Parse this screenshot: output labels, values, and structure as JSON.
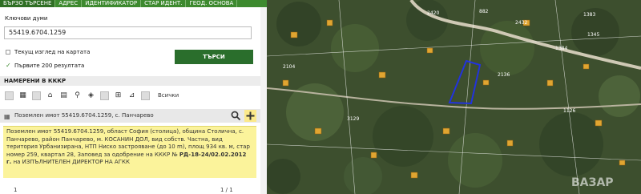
{
  "tabs": [
    {
      "label": "БЪРЗО ТЪРСЕНЕ",
      "active": true
    },
    {
      "label": "АДРЕС",
      "active": false
    },
    {
      "label": "ИДЕНТИФИКАТОР",
      "active": false
    },
    {
      "label": "СТАР ИДЕНТ.",
      "active": false
    },
    {
      "label": "ГЕОД. ОСНОВА",
      "active": false
    }
  ],
  "search": {
    "keywords_label": "Ключови думи",
    "value": "55419.6704.1259",
    "current_view_label": "Текущ изглед на картата",
    "first200_label": "Първите 200 резултата",
    "search_button": "ТЪРСИ"
  },
  "found": {
    "header": "НАМЕРЕНИ В КККР",
    "all_label": "Всички",
    "icons": [
      "grid-icon",
      "building-icon",
      "home-icon",
      "document-icon",
      "pin-icon",
      "layers-icon",
      "line-icon",
      "boundary-icon",
      "polygon-icon"
    ]
  },
  "results": {
    "title": "Поземлен имот 55419.6704.1259, с. Панчарево",
    "description": "Поземлен имот 55419.6704.1259, област София (столица), община Столична, с. Панчарево, район Панчарево, м. КОСАНИН ДОЛ, вид собств. Частна, вид територия Урбанизирана, НТП Ниско застрояване (до 10 m), площ 934 кв. м, стар номер 259, квартал 28,",
    "order_prefix": "Заповед за одобрение на КККР №",
    "order_number": "РД-18-24/02.02.2012 г.",
    "order_suffix": "на ИЗПЪЛНИТЕЛЕН ДИРЕКТОР НА АГКК",
    "page_left": "1",
    "page_right": "1 / 1"
  },
  "map": {
    "labels": [
      "2420",
      "882",
      "1383",
      "1345",
      "1384",
      "2432",
      "2136",
      "3129",
      "2104",
      "1126"
    ],
    "watermark": "ВАЗАР"
  },
  "colors": {
    "accent": "#2a6e2c",
    "tab": "#3d8a2f",
    "result_bg": "#fbf39b",
    "parcel": "#2233dd"
  }
}
